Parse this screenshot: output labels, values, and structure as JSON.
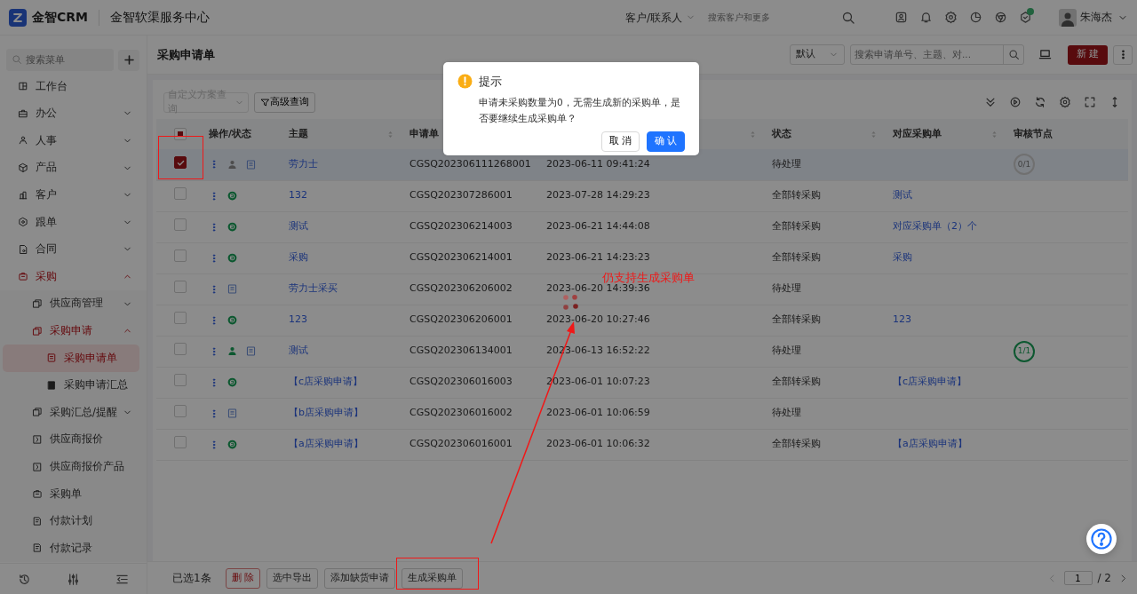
{
  "app": {
    "name": "金智CRM",
    "portal": "金智软渠服务中心"
  },
  "topbar": {
    "scope": "客户/联系人",
    "search_placeholder": "搜索客户和更多",
    "user": "朱海杰"
  },
  "sidebar": {
    "search_placeholder": "搜索菜单",
    "items": [
      {
        "label": "工作台",
        "selected": false
      },
      {
        "label": "办公",
        "selected": false,
        "expanded": false
      },
      {
        "label": "人事",
        "selected": false,
        "expanded": false
      },
      {
        "label": "产品",
        "selected": false,
        "expanded": false
      },
      {
        "label": "客户",
        "selected": false,
        "expanded": false
      },
      {
        "label": "跟单",
        "selected": false,
        "expanded": false
      },
      {
        "label": "合同",
        "selected": false,
        "expanded": false
      },
      {
        "label": "采购",
        "selected": false,
        "expanded": true,
        "children": [
          {
            "label": "供应商管理",
            "selected": false,
            "expanded": false
          },
          {
            "label": "采购申请",
            "selected": false,
            "expanded": true,
            "children": [
              {
                "label": "采购申请单",
                "selected": true
              },
              {
                "label": "采购申请汇总",
                "selected": false
              }
            ]
          },
          {
            "label": "采购汇总/提醒",
            "selected": false,
            "expanded": false
          },
          {
            "label": "供应商报价",
            "selected": false
          },
          {
            "label": "供应商报价产品",
            "selected": false
          },
          {
            "label": "采购单",
            "selected": false
          },
          {
            "label": "付款计划",
            "selected": false
          },
          {
            "label": "付款记录",
            "selected": false
          }
        ]
      }
    ]
  },
  "page": {
    "title": "采购申请单",
    "view": "默认",
    "search_placeholder": "搜索申请单号、主题、对...",
    "new_button": "新 建"
  },
  "filters": {
    "scheme_placeholder": "自定义方案查询",
    "advanced": "高级查询"
  },
  "table": {
    "select_all_partial": true,
    "columns": [
      {
        "label": "操作/状态",
        "sortable": false
      },
      {
        "label": "主题",
        "sortable": true
      },
      {
        "label": "申请单",
        "sortable": false
      },
      {
        "sortable": true
      },
      {
        "label": "状态",
        "sortable": true
      },
      {
        "label": "对应采购单",
        "sortable": true
      },
      {
        "label": "审核节点",
        "sortable": false
      }
    ],
    "rows": [
      {
        "selected": true,
        "icons": [
          {
            "kind": "approver",
            "done": false
          },
          {
            "kind": "form"
          }
        ],
        "subject": "劳力士",
        "number": "CGSQ202306111268001",
        "date": "2023-06-11 09:41:24",
        "status": "待处理",
        "review": {
          "text": "0/1",
          "done": false
        }
      },
      {
        "selected": false,
        "icons": [
          {
            "kind": "converted"
          }
        ],
        "subject": "132",
        "number": "CGSQ202307286001",
        "date": "2023-07-28 14:29:23",
        "status": "全部转采购",
        "linked": "测试"
      },
      {
        "selected": false,
        "icons": [
          {
            "kind": "converted"
          }
        ],
        "subject": "测试",
        "number": "CGSQ202306214003",
        "date": "2023-06-21 14:44:08",
        "status": "全部转采购",
        "linked": "对应采购单（2）个"
      },
      {
        "selected": false,
        "icons": [
          {
            "kind": "converted"
          }
        ],
        "subject": "采购",
        "number": "CGSQ202306214001",
        "date": "2023-06-21 14:23:23",
        "status": "全部转采购",
        "linked": "采购"
      },
      {
        "selected": false,
        "icons": [
          {
            "kind": "form"
          }
        ],
        "subject": "劳力士采买",
        "number": "CGSQ202306206002",
        "date": "2023-06-20 14:39:36",
        "status": "待处理"
      },
      {
        "selected": false,
        "icons": [
          {
            "kind": "converted"
          }
        ],
        "subject": "123",
        "number": "CGSQ202306206001",
        "date": "2023-06-20 10:27:46",
        "status": "全部转采购",
        "linked": "123"
      },
      {
        "selected": false,
        "icons": [
          {
            "kind": "approver",
            "done": true
          },
          {
            "kind": "form"
          }
        ],
        "subject": "测试",
        "number": "CGSQ202306134001",
        "date": "2023-06-13 16:52:22",
        "status": "待处理",
        "review": {
          "text": "1/1",
          "done": true
        }
      },
      {
        "selected": false,
        "icons": [
          {
            "kind": "converted"
          }
        ],
        "subject": "【c店采购申请】",
        "number": "CGSQ202306016003",
        "date": "2023-06-01 10:07:23",
        "status": "全部转采购",
        "linked": "【c店采购申请】"
      },
      {
        "selected": false,
        "icons": [
          {
            "kind": "form"
          }
        ],
        "subject": "【b店采购申请】",
        "number": "CGSQ202306016002",
        "date": "2023-06-01 10:06:59",
        "status": "待处理"
      },
      {
        "selected": false,
        "icons": [
          {
            "kind": "converted"
          }
        ],
        "subject": "【a店采购申请】",
        "number": "CGSQ202306016001",
        "date": "2023-06-01 10:06:32",
        "status": "全部转采购",
        "linked": "【a店采购申请】"
      }
    ]
  },
  "footer": {
    "selected_count": "已选1条",
    "actions": [
      {
        "label": "删 除",
        "kind": "danger"
      },
      {
        "label": "选中导出",
        "kind": "default"
      },
      {
        "label": "添加缺货申请",
        "kind": "default"
      },
      {
        "label": "生成采购单",
        "kind": "default"
      }
    ],
    "pager": {
      "page": "1",
      "total": "/ 2"
    }
  },
  "dialog": {
    "title": "提示",
    "message": "申请未采购数量为0，无需生成新的采购单，是否要继续生成采购单？",
    "cancel": "取 消",
    "confirm": "确 认"
  },
  "annotation": {
    "note": "仍支持生成采购单"
  }
}
